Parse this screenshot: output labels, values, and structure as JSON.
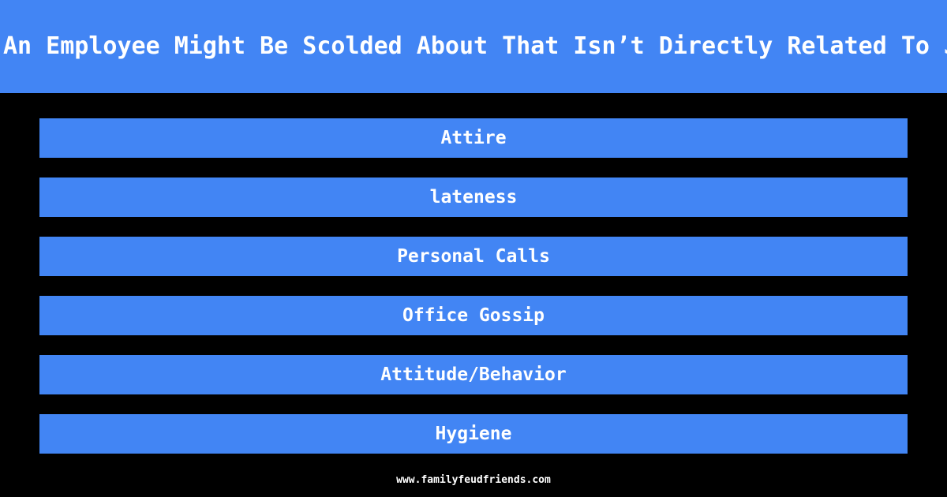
{
  "header": {
    "question": "Name Something An Employee Might Be Scolded About That Isn’t Directly Related To Job Performance",
    "visible_fragment": "hing An Employee Might Be Scolded About That Isn’t Directly Related To Job P",
    "background_color": "#4285f4",
    "text_color": "#ffffff"
  },
  "answers": [
    {
      "rank": 1,
      "label": "Attire"
    },
    {
      "rank": 2,
      "label": "lateness"
    },
    {
      "rank": 3,
      "label": "Personal Calls"
    },
    {
      "rank": 4,
      "label": "Office Gossip"
    },
    {
      "rank": 5,
      "label": "Attitude/Behavior"
    },
    {
      "rank": 6,
      "label": "Hygiene"
    }
  ],
  "footer": {
    "url": "www.familyfeudfriends.com"
  },
  "theme": {
    "page_background": "#000000",
    "bar_color": "#4285f4",
    "bar_text_color": "#ffffff",
    "footer_text_color": "#ffffff"
  }
}
